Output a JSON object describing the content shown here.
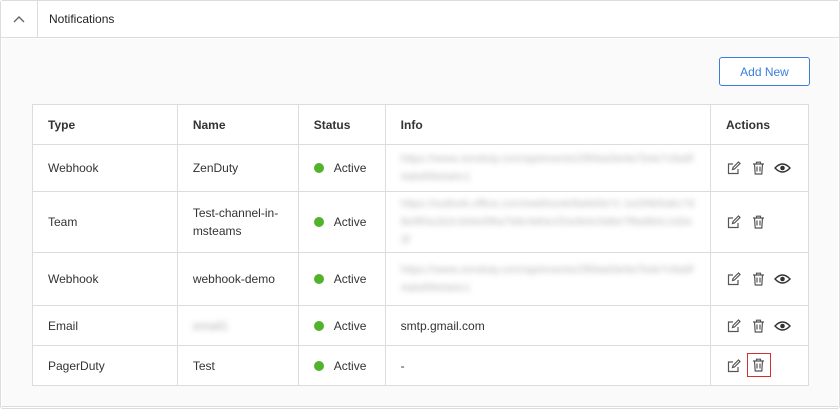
{
  "panel": {
    "title": "Notifications",
    "add_label": "Add New"
  },
  "table": {
    "headers": [
      "Type",
      "Name",
      "Status",
      "Info",
      "Actions"
    ],
    "rows": [
      {
        "type": "Webhook",
        "name": "ZenDuty",
        "status": "Active",
        "info": "https://www.zenduty.com/api/events/2f89ad3e9a7b4e7c8a9f4abd5fe0a0c1",
        "actions": [
          "edit",
          "delete",
          "view"
        ]
      },
      {
        "type": "Team",
        "name": "Test-channel-in-msteams",
        "status": "Active",
        "info": "https://outlook.office.com/webhook/8a9d3e7c-1e2f4b5a6c7d8e9f0a1b2c3d4e5f6a7b8c9d0e1f2a3b4c5d6e7f8a9b0c1d2e3f",
        "actions": [
          "edit",
          "delete"
        ]
      },
      {
        "type": "Webhook",
        "name": "webhook-demo",
        "status": "Active",
        "info": "https://www.zenduty.com/api/events/2f89ad3e9a7b4e7c8a9f4abd5fe0a0c1",
        "actions": [
          "edit",
          "delete",
          "view"
        ]
      },
      {
        "type": "Email",
        "name": "email1",
        "status": "Active",
        "info": "smtp.gmail.com",
        "actions": [
          "edit",
          "delete",
          "view"
        ]
      },
      {
        "type": "PagerDuty",
        "name": "Test",
        "status": "Active",
        "info": "-",
        "actions": [
          "edit",
          "delete"
        ]
      }
    ]
  },
  "colors": {
    "status_active": "#52b22c",
    "accent": "#3b7ddd",
    "highlight": "#d32f2f"
  }
}
